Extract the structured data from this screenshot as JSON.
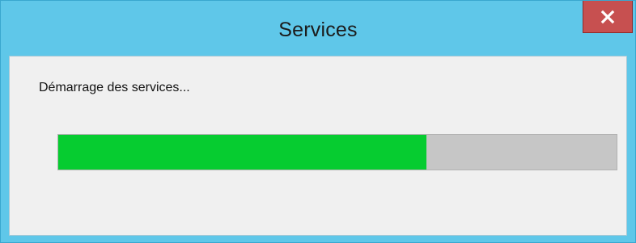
{
  "window": {
    "title": "Services",
    "close_icon": "close-icon"
  },
  "dialog": {
    "status_text": "Démarrage des services...",
    "progress_fraction": 0.66
  },
  "colors": {
    "titlebar": "#5fc7e9",
    "close_button": "#c75050",
    "client_background": "#f0f0f0",
    "progress_fill": "#06cc30",
    "progress_track": "#c6c6c6"
  }
}
